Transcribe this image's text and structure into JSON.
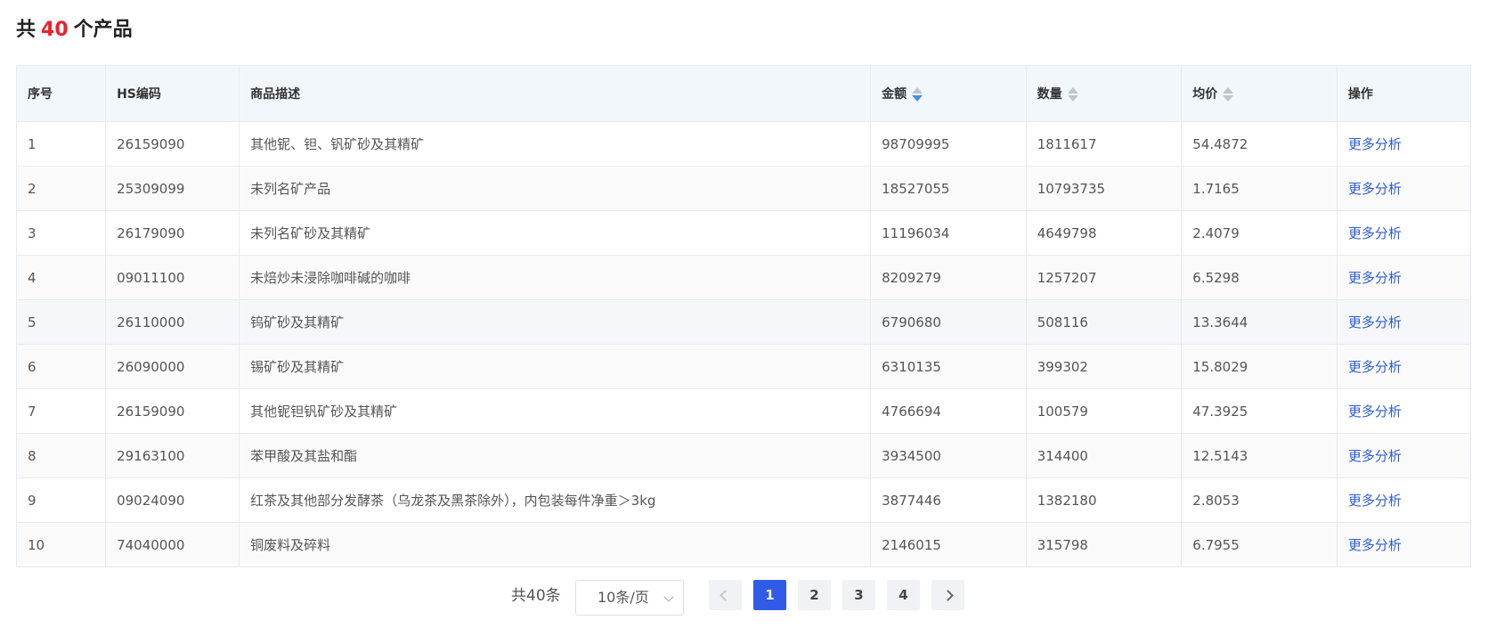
{
  "title": {
    "prefix": "共",
    "count": "40",
    "suffix": "个产品"
  },
  "colors": {
    "accent_red": "#e8232b",
    "link_blue": "#2f5dd6",
    "page_active": "#2f5be6"
  },
  "table": {
    "headers": [
      "序号",
      "HS编码",
      "商品描述",
      "金额",
      "数量",
      "均价",
      "操作"
    ],
    "sort_state": {
      "金额": "descending",
      "数量": "none",
      "均价": "none"
    },
    "rows": [
      {
        "no": "1",
        "hs": "26159090",
        "desc": "其他铌、钽、钒矿砂及其精矿",
        "amount": "98709995",
        "qty": "1811617",
        "avg": "54.4872",
        "action": "更多分析"
      },
      {
        "no": "2",
        "hs": "25309099",
        "desc": "未列名矿产品",
        "amount": "18527055",
        "qty": "10793735",
        "avg": "1.7165",
        "action": "更多分析"
      },
      {
        "no": "3",
        "hs": "26179090",
        "desc": "未列名矿砂及其精矿",
        "amount": "11196034",
        "qty": "4649798",
        "avg": "2.4079",
        "action": "更多分析"
      },
      {
        "no": "4",
        "hs": "09011100",
        "desc": "未焙炒未浸除咖啡碱的咖啡",
        "amount": "8209279",
        "qty": "1257207",
        "avg": "6.5298",
        "action": "更多分析"
      },
      {
        "no": "5",
        "hs": "26110000",
        "desc": "钨矿砂及其精矿",
        "amount": "6790680",
        "qty": "508116",
        "avg": "13.3644",
        "action": "更多分析"
      },
      {
        "no": "6",
        "hs": "26090000",
        "desc": "锡矿砂及其精矿",
        "amount": "6310135",
        "qty": "399302",
        "avg": "15.8029",
        "action": "更多分析"
      },
      {
        "no": "7",
        "hs": "26159090",
        "desc": "其他铌钽钒矿砂及其精矿",
        "amount": "4766694",
        "qty": "100579",
        "avg": "47.3925",
        "action": "更多分析"
      },
      {
        "no": "8",
        "hs": "29163100",
        "desc": "苯甲酸及其盐和酯",
        "amount": "3934500",
        "qty": "314400",
        "avg": "12.5143",
        "action": "更多分析"
      },
      {
        "no": "9",
        "hs": "09024090",
        "desc": "红茶及其他部分发酵茶（乌龙茶及黑茶除外），内包装每件净重＞3kg",
        "amount": "3877446",
        "qty": "1382180",
        "avg": "2.8053",
        "action": "更多分析"
      },
      {
        "no": "10",
        "hs": "74040000",
        "desc": "铜废料及碎料",
        "amount": "2146015",
        "qty": "315798",
        "avg": "6.7955",
        "action": "更多分析"
      }
    ]
  },
  "pagination": {
    "total_label": "共40条",
    "page_size": "10条/页",
    "pages": [
      "1",
      "2",
      "3",
      "4"
    ],
    "current_page": "1"
  }
}
